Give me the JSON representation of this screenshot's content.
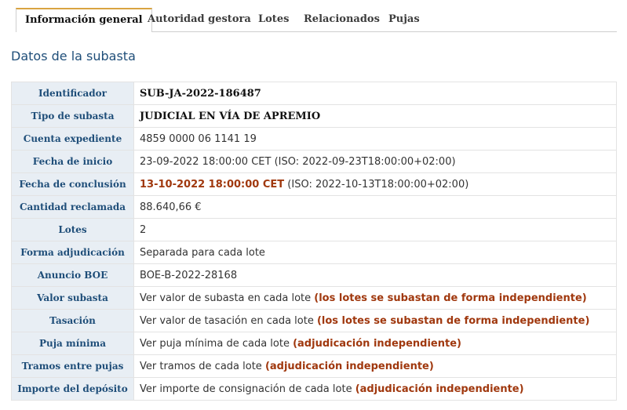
{
  "tabs": [
    "Información general",
    "Autoridad gestora",
    "Lotes",
    "Relacionados",
    "Pujas"
  ],
  "section_title": "Datos de la subasta",
  "rows": {
    "identificador": {
      "label": "Identificador",
      "value": "SUB-JA-2022-186487"
    },
    "tipo": {
      "label": "Tipo de subasta",
      "value": "JUDICIAL EN VÍA DE APREMIO"
    },
    "cuenta": {
      "label": "Cuenta expediente",
      "value": "4859 0000 06 1141 19"
    },
    "inicio": {
      "label": "Fecha de inicio",
      "value": "23-09-2022 18:00:00 CET (ISO: 2022-09-23T18:00:00+02:00)"
    },
    "conclusion": {
      "label": "Fecha de conclusión",
      "value_main": "13-10-2022 18:00:00 CET",
      "value_iso": " (ISO: 2022-10-13T18:00:00+02:00)"
    },
    "cantidad": {
      "label": "Cantidad reclamada",
      "value": "88.640,66 €"
    },
    "lotes": {
      "label": "Lotes",
      "value": "2"
    },
    "forma": {
      "label": "Forma adjudicación",
      "value": "Separada para cada lote"
    },
    "boe": {
      "label": "Anuncio BOE",
      "value": "BOE-B-2022-28168"
    },
    "valor": {
      "label": "Valor subasta",
      "value": "Ver valor de subasta en cada lote ",
      "note": "(los lotes se subastan de forma independiente)"
    },
    "tasacion": {
      "label": "Tasación",
      "value": "Ver valor de tasación en cada lote ",
      "note": "(los lotes se subastan de forma independiente)"
    },
    "puja": {
      "label": "Puja mínima",
      "value": "Ver puja mínima de cada lote ",
      "note": "(adjudicación independiente)"
    },
    "tramos": {
      "label": "Tramos entre pujas",
      "value": "Ver tramos de cada lote ",
      "note": "(adjudicación independiente)"
    },
    "deposito": {
      "label": "Importe del depósito",
      "value": "Ver importe de consignación de cada lote ",
      "note": "(adjudicación independiente)"
    }
  }
}
